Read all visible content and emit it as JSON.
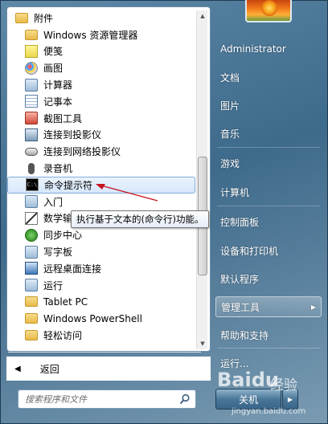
{
  "left_panel": {
    "root_folder": "附件",
    "items": [
      {
        "label": "Windows 资源管理器",
        "icon": "explorer-icon"
      },
      {
        "label": "便笺",
        "icon": "sticky-notes-icon"
      },
      {
        "label": "画图",
        "icon": "paint-icon"
      },
      {
        "label": "计算器",
        "icon": "calculator-icon"
      },
      {
        "label": "记事本",
        "icon": "notepad-icon"
      },
      {
        "label": "截图工具",
        "icon": "snipping-tool-icon"
      },
      {
        "label": "连接到投影仪",
        "icon": "projector-icon"
      },
      {
        "label": "连接到网络投影仪",
        "icon": "network-projector-icon"
      },
      {
        "label": "录音机",
        "icon": "microphone-icon"
      },
      {
        "label": "命令提示符",
        "icon": "command-prompt-icon"
      },
      {
        "label": "入门",
        "icon": "getting-started-icon"
      },
      {
        "label": "数学输入面板",
        "icon": "math-input-icon"
      },
      {
        "label": "同步中心",
        "icon": "sync-center-icon"
      },
      {
        "label": "写字板",
        "icon": "wordpad-icon"
      },
      {
        "label": "远程桌面连接",
        "icon": "remote-desktop-icon"
      },
      {
        "label": "运行",
        "icon": "run-icon"
      }
    ],
    "folders": [
      {
        "label": "Tablet PC",
        "icon": "folder-icon"
      },
      {
        "label": "Windows PowerShell",
        "icon": "folder-icon"
      },
      {
        "label": "轻松访问",
        "icon": "folder-icon"
      }
    ],
    "back_label": "返回",
    "tooltip": "执行基于文本的(命令行)功能。"
  },
  "search": {
    "placeholder": "搜索程序和文件"
  },
  "right_panel": {
    "items": [
      {
        "label": "Administrator"
      },
      {
        "label": "文档"
      },
      {
        "label": "图片"
      },
      {
        "label": "音乐"
      },
      {
        "label": "游戏"
      },
      {
        "label": "计算机"
      },
      {
        "label": "控制面板"
      },
      {
        "label": "设备和打印机"
      },
      {
        "label": "默认程序"
      },
      {
        "label": "管理工具"
      },
      {
        "label": "帮助和支持"
      },
      {
        "label": "运行..."
      }
    ],
    "shutdown_label": "关机"
  },
  "watermark": {
    "logo": "Baidu",
    "cn": "经验",
    "url": "jingyan.baidu.com"
  },
  "colors": {
    "highlight_border": "#84acdd",
    "annotation_arrow": "#c8141e",
    "menu_glass": "#4a7797"
  }
}
